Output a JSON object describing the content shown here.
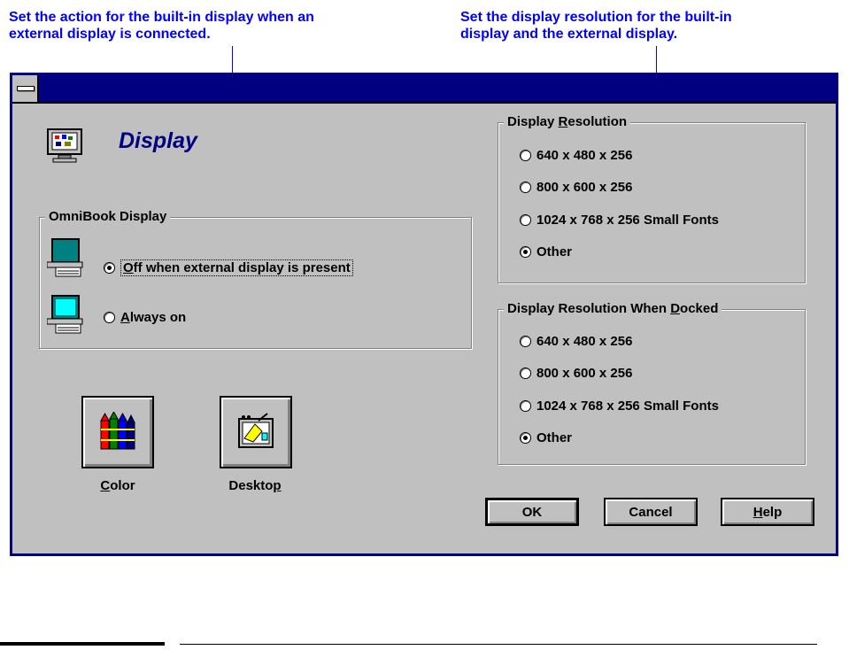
{
  "callouts": {
    "left_line1": "Set the action for the built-in display when an",
    "left_line2": "external display is connected.",
    "right_line1": "Set the display resolution for the built-in",
    "right_line2": "display and the external display."
  },
  "dialog": {
    "heading": "Display",
    "omnibook_group": {
      "title": "OmniBook Display",
      "options": [
        {
          "pre": "",
          "mnemonic": "O",
          "post": "ff when external display is present",
          "selected": true
        },
        {
          "pre": "",
          "mnemonic": "A",
          "post": "lways on",
          "selected": false
        }
      ]
    },
    "resolution_group": {
      "title_pre": "Display ",
      "title_mnemonic": "R",
      "title_post": "esolution",
      "options": [
        {
          "label": "640 x 480 x 256",
          "selected": false
        },
        {
          "label": "800 x 600 x 256",
          "selected": false
        },
        {
          "label": "1024 x 768 x 256 Small Fonts",
          "selected": false
        },
        {
          "label": "Other",
          "selected": true
        }
      ]
    },
    "docked_group": {
      "title_pre": "Display Resolution When ",
      "title_mnemonic": "D",
      "title_post": "ocked",
      "options": [
        {
          "label": "640 x 480 x 256",
          "selected": false
        },
        {
          "label": "800 x 600 x 256",
          "selected": false
        },
        {
          "label": "1024 x 768 x 256 Small Fonts",
          "selected": false
        },
        {
          "label": "Other",
          "selected": true
        }
      ]
    },
    "color_button": {
      "mnemonic": "C",
      "post": "olor",
      "icon": "crayons-icon"
    },
    "desktop_button": {
      "pre": "Deskto",
      "mnemonic": "p",
      "post": "",
      "icon": "desktop-icon"
    },
    "ok_label": "OK",
    "cancel_label": "Cancel",
    "help_mnemonic": "H",
    "help_post": "elp"
  },
  "colors": {
    "callout": "#0000ff",
    "titlebar": "#000080",
    "face": "#c0c0c0"
  }
}
